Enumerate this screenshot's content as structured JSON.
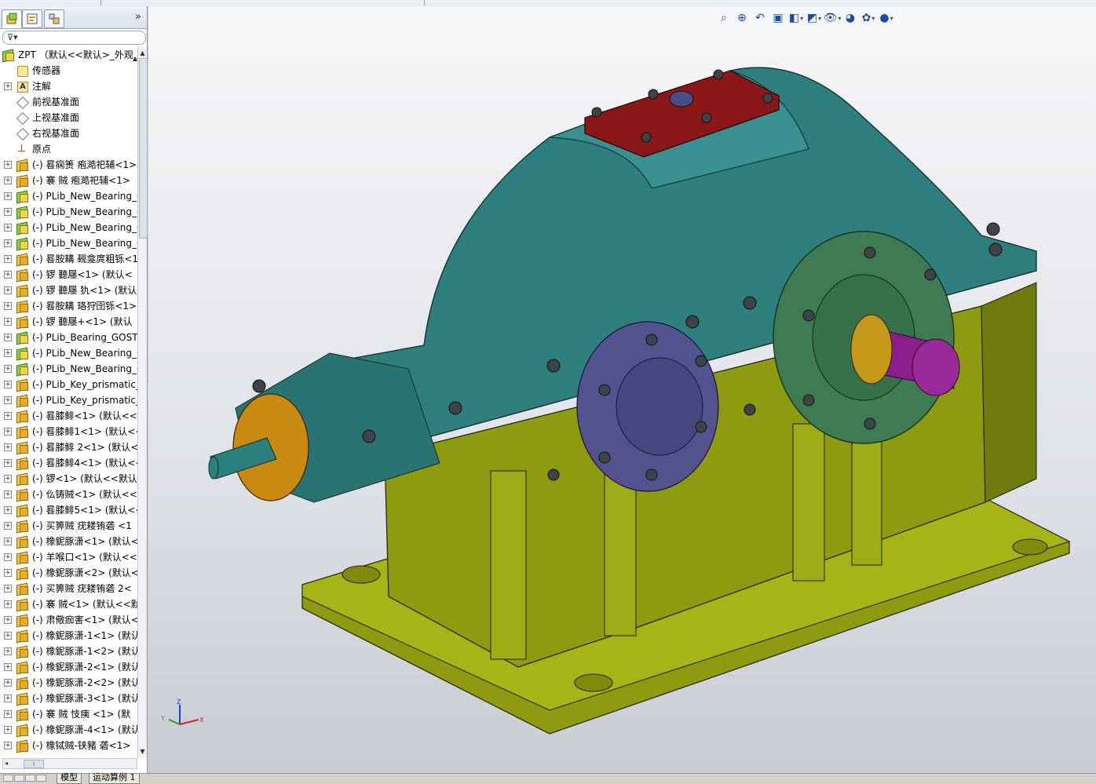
{
  "panel": {
    "tabs": [
      {
        "name": "featuremanager-tab",
        "icon": "featuremanager-icon"
      },
      {
        "name": "propertymanager-tab",
        "icon": "propertymanager-icon"
      },
      {
        "name": "configurationmanager-tab",
        "icon": "configurationmanager-icon"
      }
    ],
    "collapse_label": "»",
    "filter_icon": "filter-icon",
    "splitter_label": "‹"
  },
  "tree": {
    "root": "ZPT （默认<<默认>_外观 显",
    "items": [
      {
        "label": "传感器",
        "icon": "sensor",
        "expand": false
      },
      {
        "label": "注解",
        "icon": "annotation",
        "expand": true
      },
      {
        "label": "前视基准面",
        "icon": "plane",
        "expand": false
      },
      {
        "label": "上视基准面",
        "icon": "plane",
        "expand": false
      },
      {
        "label": "右视基准面",
        "icon": "plane",
        "expand": false
      },
      {
        "label": "原点",
        "icon": "origin",
        "expand": false
      },
      {
        "label": "(-) 晷痫箦 疱澔祀辅<1>",
        "icon": "part",
        "expand": true
      },
      {
        "label": "(-) 褰  贼 疱澔祀辅<1>",
        "icon": "part",
        "expand": true
      },
      {
        "label": "(-) PLib_New_Bearing_G",
        "icon": "part-green",
        "expand": true
      },
      {
        "label": "(-) PLib_New_Bearing_G",
        "icon": "part-green",
        "expand": true
      },
      {
        "label": "(-) PLib_New_Bearing_G",
        "icon": "part-green",
        "expand": true
      },
      {
        "label": "(-) PLib_New_Bearing_G",
        "icon": "part-green",
        "expand": true
      },
      {
        "label": "(-) 晷胺耩 觋龛庹粗铄<1",
        "icon": "part",
        "expand": true
      },
      {
        "label": "(-) 锣    聽屦<1> (默认<",
        "icon": "part",
        "expand": true
      },
      {
        "label": "(-) 锣    聽屦 犰<1> (默认",
        "icon": "part",
        "expand": true
      },
      {
        "label": "(-) 晷胺耩 珞狩囹铄<1>",
        "icon": "part",
        "expand": true
      },
      {
        "label": "(-) 锣    聽屦+<1> (默认",
        "icon": "part",
        "expand": true
      },
      {
        "label": "(-) PLib_Bearing_GOST_",
        "icon": "part-green",
        "expand": true
      },
      {
        "label": "(-) PLib_New_Bearing_G",
        "icon": "part-green",
        "expand": true
      },
      {
        "label": "(-) PLib_New_Bearing_G",
        "icon": "part-green",
        "expand": true
      },
      {
        "label": "(-) PLib_Key_prismatic_",
        "icon": "part",
        "expand": true
      },
      {
        "label": "(-) PLib_Key_prismatic_",
        "icon": "part",
        "expand": true
      },
      {
        "label": "(-) 晷膝鲱<1> (默认<<默",
        "icon": "part",
        "expand": true
      },
      {
        "label": "(-) 晷膝鲱1<1> (默认<<",
        "icon": "part",
        "expand": true
      },
      {
        "label": "(-) 晷膝鲱 2<1> (默认<",
        "icon": "part",
        "expand": true
      },
      {
        "label": "(-) 晷膝鲱4<1> (默认<<",
        "icon": "part",
        "expand": true
      },
      {
        "label": "(-) 锣<1> (默认<<默认",
        "icon": "part",
        "expand": true
      },
      {
        "label": "(-) 仫铸贼<1> (默认<<默",
        "icon": "part",
        "expand": true
      },
      {
        "label": "(-) 晷膝鲱5<1> (默认<<",
        "icon": "part",
        "expand": true
      },
      {
        "label": "(-) 买箅贼 疣耧铕砻    <1",
        "icon": "part",
        "expand": true
      },
      {
        "label": "(-) 橡鈮豚潇<1> (默认<",
        "icon": "part",
        "expand": true
      },
      {
        "label": "(-) 羊喉口<1> (默认<<默",
        "icon": "part",
        "expand": true
      },
      {
        "label": "(-) 橡鈮豚潇<2> (默认<",
        "icon": "part",
        "expand": true
      },
      {
        "label": "(-) 买箅贼 疣耧铕砻   2<",
        "icon": "part",
        "expand": true
      },
      {
        "label": "(-) 褰    贼<1> (默认<<默",
        "icon": "part",
        "expand": true
      },
      {
        "label": "(-) 肃儆痂害<1> (默认<",
        "icon": "part",
        "expand": true
      },
      {
        "label": "(-) 橡鈮豚潇-1<1> (默认",
        "icon": "part",
        "expand": true
      },
      {
        "label": "(-) 橡鈮豚潇-1<2> (默认",
        "icon": "part",
        "expand": true
      },
      {
        "label": "(-) 橡鈮豚潇-2<1> (默认",
        "icon": "part",
        "expand": true
      },
      {
        "label": "(-) 橡鈮豚潇-2<2> (默认",
        "icon": "part",
        "expand": true
      },
      {
        "label": "(-) 橡鈮豚潇-3<1> (默认",
        "icon": "part",
        "expand": true
      },
      {
        "label": "(-) 褰  贼 忮痍    <1> (默",
        "icon": "part",
        "expand": true
      },
      {
        "label": "(-) 橡鈮豚潇-4<1> (默认",
        "icon": "part",
        "expand": true
      },
      {
        "label": "(-) 橡铽贼-铗豬    砻<1>",
        "icon": "part",
        "expand": true
      }
    ]
  },
  "view_toolbar": [
    {
      "name": "zoom-to-fit-icon",
      "glyph": "⌕",
      "drop": false
    },
    {
      "name": "zoom-to-area-icon",
      "glyph": "⊕",
      "drop": false
    },
    {
      "name": "previous-view-icon",
      "glyph": "↶",
      "drop": false
    },
    {
      "name": "section-view-icon",
      "glyph": "▣",
      "drop": false
    },
    {
      "name": "view-orientation-icon",
      "glyph": "◧",
      "drop": true
    },
    {
      "name": "display-style-icon",
      "glyph": "◩",
      "drop": true
    },
    {
      "name": "hide-show-items-icon",
      "glyph": "👁",
      "drop": true
    },
    {
      "name": "edit-appearance-icon",
      "glyph": "◕",
      "drop": false
    },
    {
      "name": "apply-scene-icon",
      "glyph": "✿",
      "drop": true
    },
    {
      "name": "view-settings-icon",
      "glyph": "●",
      "drop": true
    }
  ],
  "triad": {
    "x": "X",
    "y": "Y",
    "z": "Z"
  },
  "bottom_tabs": [
    "模型",
    "运动算例 1"
  ],
  "colors": {
    "housing_top": "#2f7f7f",
    "housing_bottom": "#8e9a10",
    "cover_plate": "#8a1818",
    "flange_blue": "#52528e",
    "flange_orange": "#c98a12",
    "flange_green": "#3f7b52",
    "shaft_purple": "#8a1e8a",
    "bolt": "#3e4347"
  }
}
